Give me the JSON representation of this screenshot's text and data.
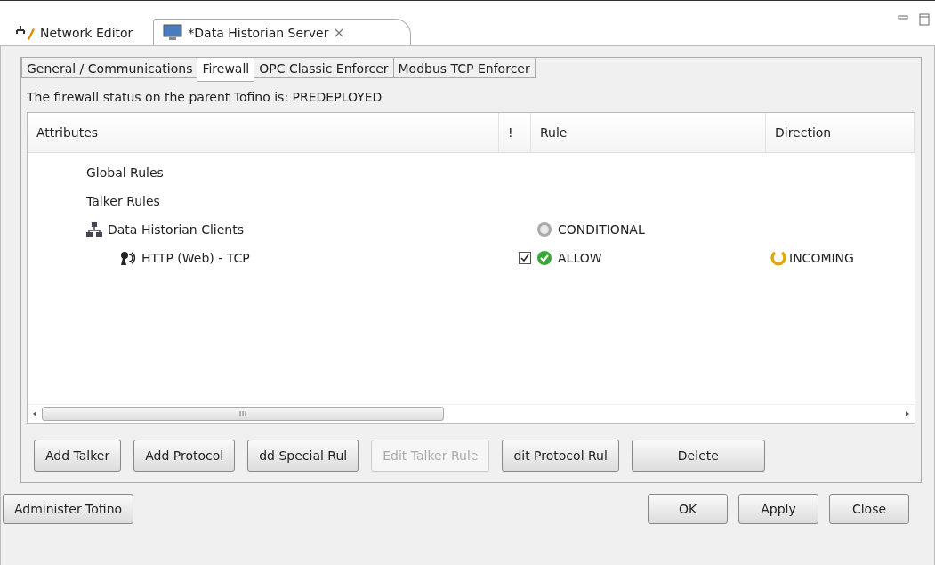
{
  "editor_tabs": [
    {
      "label": "Network Editor",
      "selected": false
    },
    {
      "label": "*Data Historian Server",
      "selected": true
    }
  ],
  "tabs": [
    {
      "label": "General / Communications",
      "selected": false
    },
    {
      "label": "Firewall",
      "selected": true
    },
    {
      "label": "OPC Classic Enforcer",
      "selected": false
    },
    {
      "label": "Modbus TCP Enforcer",
      "selected": false
    }
  ],
  "status": "The firewall status on the parent Tofino is: PREDEPLOYED",
  "table": {
    "columns": [
      "Attributes",
      "!",
      "Rule",
      "Direction"
    ],
    "rows": [
      {
        "label": "Global Rules",
        "kind": "group"
      },
      {
        "label": "Talker Rules",
        "kind": "group"
      },
      {
        "label": "Data Historian Clients",
        "kind": "talker",
        "rule": {
          "text": "CONDITIONAL",
          "kind": "conditional"
        },
        "children": [
          {
            "label": "HTTP (Web) - TCP",
            "kind": "protocol",
            "checked": true,
            "rule": {
              "text": "ALLOW",
              "kind": "allow"
            },
            "direction": {
              "text": "INCOMING",
              "kind": "incoming"
            }
          }
        ]
      }
    ]
  },
  "buttons": [
    {
      "label": "Add Talker",
      "disabled": false
    },
    {
      "label": "Add Protocol",
      "disabled": false
    },
    {
      "label": "dd Special Rul",
      "disabled": false
    },
    {
      "label": "Edit Talker Rule",
      "disabled": true
    },
    {
      "label": "dit Protocol Rul",
      "disabled": false
    },
    {
      "label": "Delete",
      "disabled": false
    }
  ],
  "footer_left": "Administer Tofino",
  "footer_buttons": [
    "OK",
    "Apply",
    "Close"
  ]
}
